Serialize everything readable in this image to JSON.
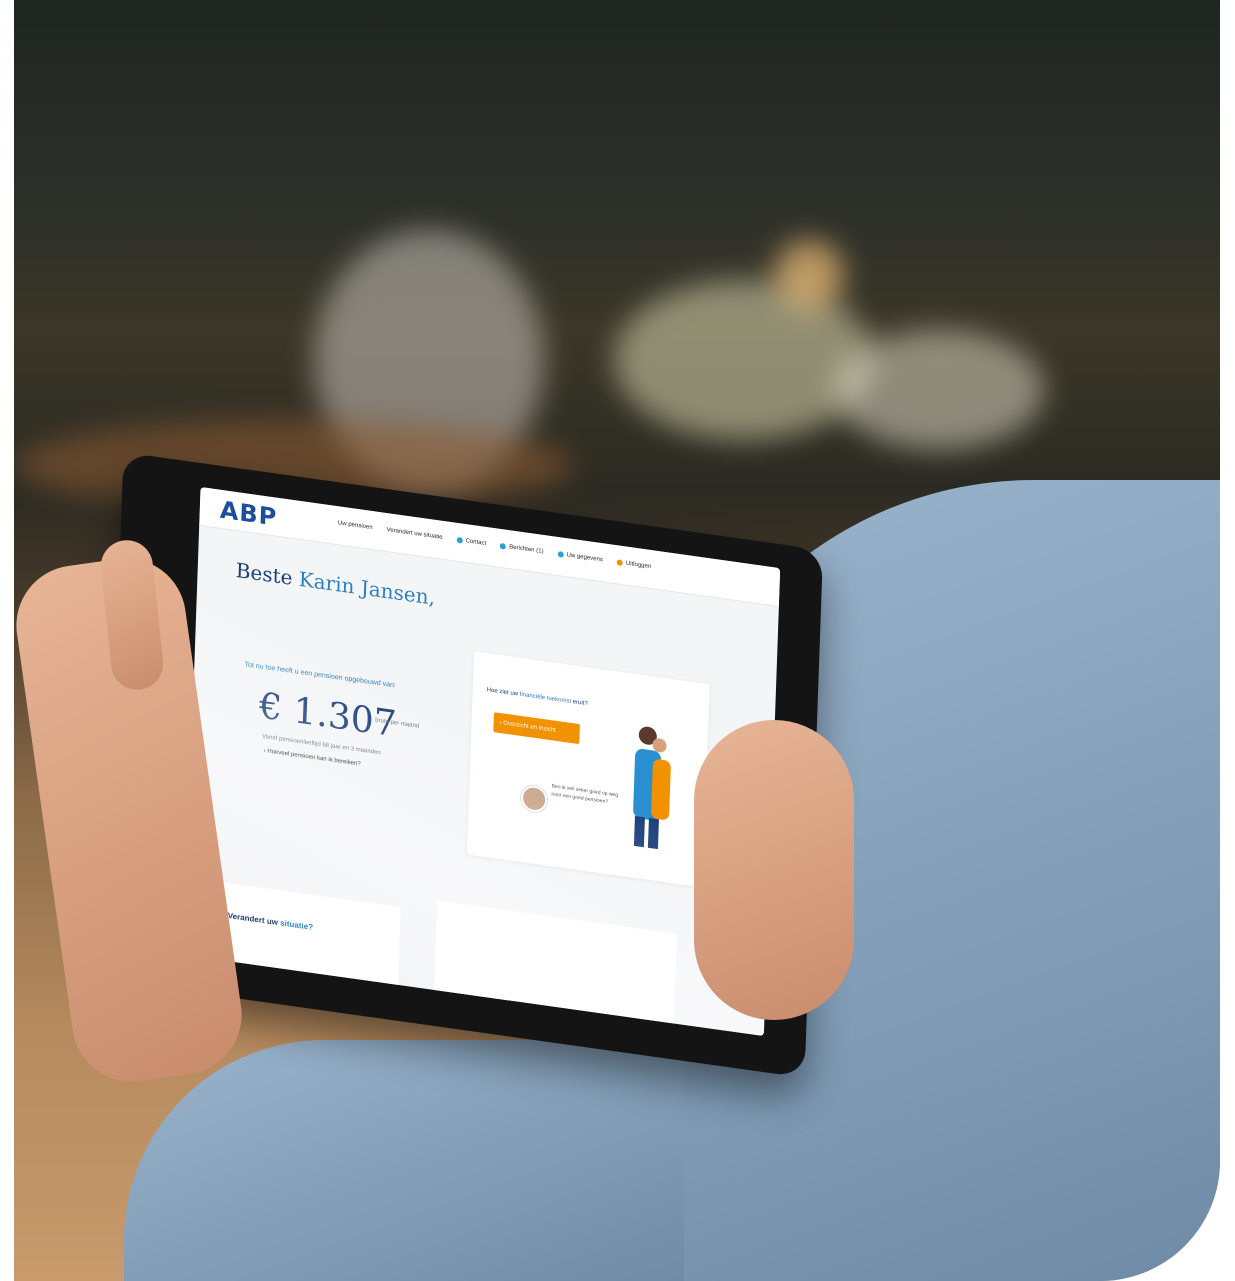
{
  "site": {
    "logo": "ABP",
    "nav": [
      {
        "label": "Uw pensioen",
        "icon": "none"
      },
      {
        "label": "Verandert uw situatie",
        "icon": "none"
      },
      {
        "label": "Contact",
        "icon": "chat-icon"
      },
      {
        "label": "Berichten (1)",
        "icon": "mail-icon"
      },
      {
        "label": "Uw gegevens",
        "icon": "user-icon"
      },
      {
        "label": "Uitloggen",
        "icon": "logout-icon"
      }
    ]
  },
  "main": {
    "greeting_prefix": "Beste ",
    "greeting_name": "Karin Jansen,",
    "accrued_line": "Tot nu toe heeft u een pensioen opgebouwd van:",
    "amount": "€ 1.307",
    "amount_unit": "bruto per maand",
    "footnote": "Vanaf pensioenleeftijd 68 jaar en 3 maanden",
    "link": "Hoeveel pensioen kan ik bereiken?"
  },
  "card": {
    "title_prefix": "Hoe ziet uw ",
    "title_highlight": "financiële toekomst",
    "title_suffix": " eruit?",
    "cta_label": "› Overzicht en inzicht",
    "quote": "Ben ik wel zeker goed op weg naar een goed pensioen?"
  },
  "bottom": {
    "title_prefix": "Verandert uw ",
    "title_highlight": "situatie?"
  },
  "colors": {
    "brand_blue": "#1b3f7a",
    "accent_blue": "#2e7fc2",
    "cta_orange": "#f39200"
  }
}
